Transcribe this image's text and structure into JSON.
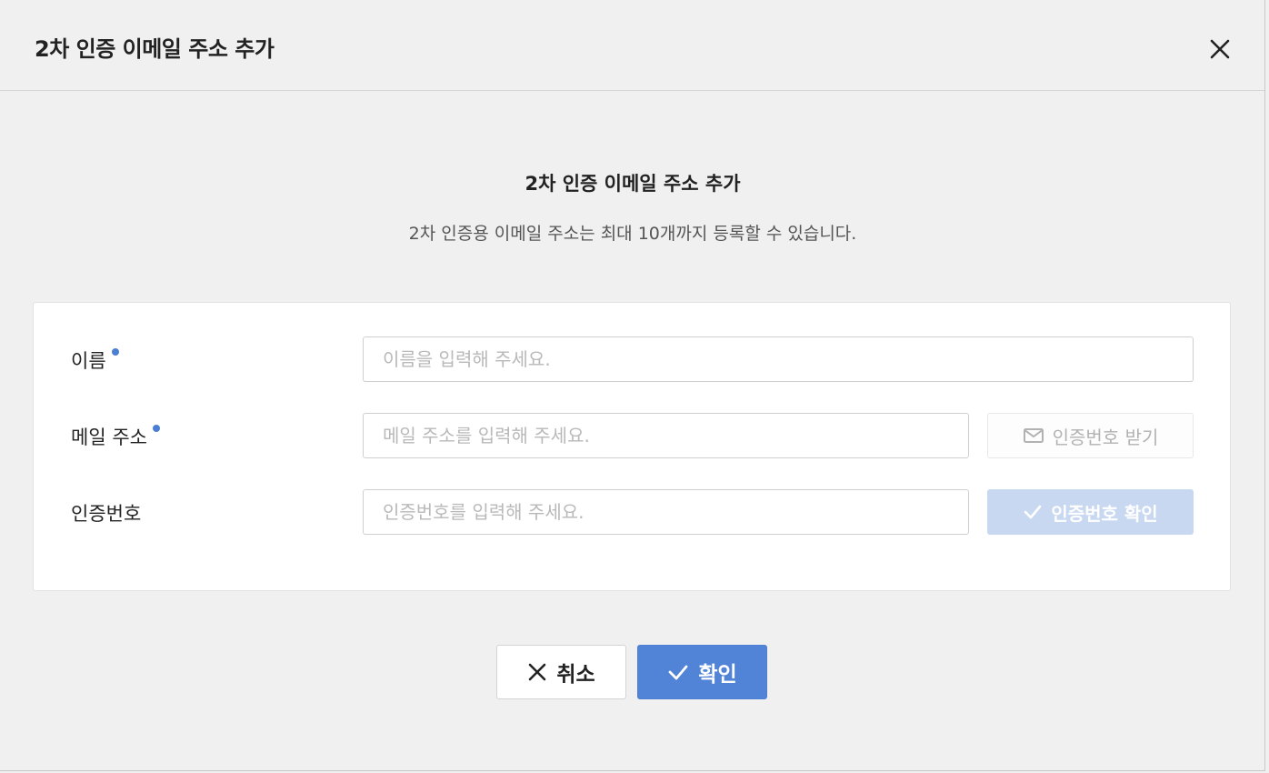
{
  "dialog": {
    "title": "2차 인증 이메일 주소 추가",
    "close_icon": "close-icon"
  },
  "intro": {
    "heading": "2차 인증 이메일 주소 추가",
    "description": "2차 인증용 이메일 주소는 최대 10개까지 등록할 수 있습니다."
  },
  "form": {
    "name": {
      "label": "이름",
      "required": true,
      "value": "",
      "placeholder": "이름을 입력해 주세요."
    },
    "email": {
      "label": "메일 주소",
      "required": true,
      "value": "",
      "placeholder": "메일 주소를 입력해 주세요.",
      "send_button_label": "인증번호 받기",
      "send_button_icon": "envelope-icon"
    },
    "code": {
      "label": "인증번호",
      "required": false,
      "value": "",
      "placeholder": "인증번호를 입력해 주세요.",
      "verify_button_label": "인증번호 확인",
      "verify_button_icon": "check-icon"
    },
    "required_dot_color": "#4a7fd4"
  },
  "footer": {
    "cancel_label": "취소",
    "cancel_icon": "close-icon",
    "confirm_label": "확인",
    "confirm_icon": "check-icon"
  },
  "colors": {
    "accent": "#5183d6",
    "accent_disabled": "#c9d8f1",
    "background": "#f0f0f0"
  }
}
